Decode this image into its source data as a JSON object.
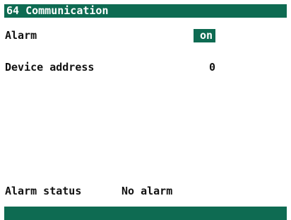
{
  "header": {
    "title": "64 Communication"
  },
  "settings": {
    "alarm": {
      "label": "Alarm",
      "value": "on"
    },
    "device_address": {
      "label": "Device address",
      "value": "0"
    }
  },
  "status": {
    "label": "Alarm status",
    "value": "No alarm"
  },
  "colors": {
    "accent": "#0e6b52",
    "background": "#ffffff",
    "text": "#111111"
  }
}
